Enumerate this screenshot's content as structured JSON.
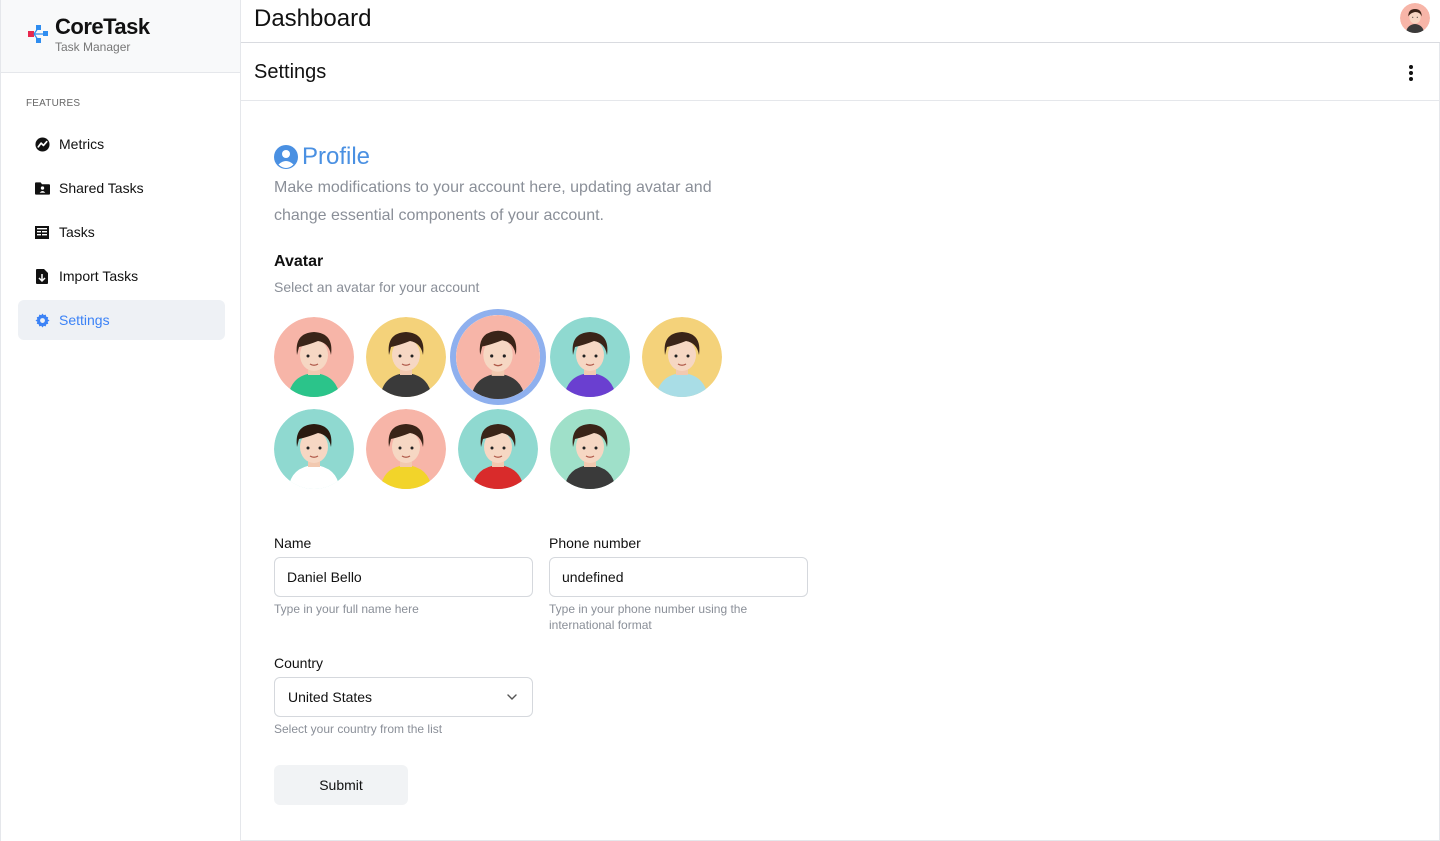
{
  "brand": {
    "name": "CoreTask",
    "subtitle": "Task Manager",
    "logo_icon": "coretask-logo-icon"
  },
  "sidebar": {
    "section_label": "FEATURES",
    "items": [
      {
        "label": "Metrics",
        "icon": "chart-line-icon",
        "active": false
      },
      {
        "label": "Shared Tasks",
        "icon": "shared-folder-icon",
        "active": false
      },
      {
        "label": "Tasks",
        "icon": "task-list-icon",
        "active": false
      },
      {
        "label": "Import Tasks",
        "icon": "file-import-icon",
        "active": false
      },
      {
        "label": "Settings",
        "icon": "gear-icon",
        "active": true
      }
    ]
  },
  "header": {
    "title": "Dashboard",
    "user_avatar_icon": "user-avatar"
  },
  "settings_bar": {
    "title": "Settings",
    "menu_icon": "more-vertical-icon"
  },
  "profile": {
    "title": "Profile",
    "icon": "user-circle-icon",
    "description": "Make modifications to your account here, updating avatar and change essential components of your account."
  },
  "avatar_section": {
    "title": "Avatar",
    "subtitle": "Select an avatar for your account",
    "selected_index": 2,
    "avatars": [
      {
        "bg": "#f7b5a8",
        "shirt": "#2bc48a",
        "hair": "#3a2418"
      },
      {
        "bg": "#f4d27a",
        "shirt": "#3a3a3a",
        "hair": "#3a2418"
      },
      {
        "bg": "#f7b5a8",
        "shirt": "#3a3a3a",
        "hair": "#3a2418"
      },
      {
        "bg": "#8fd9d0",
        "shirt": "#6a3fd0",
        "hair": "#3a2418"
      },
      {
        "bg": "#f4d27a",
        "shirt": "#a9dde6",
        "hair": "#3a2418"
      },
      {
        "bg": "#8fd9d0",
        "shirt": "#ffffff",
        "hair": "#2a1a10"
      },
      {
        "bg": "#f7b5a8",
        "shirt": "#f2d42a",
        "hair": "#3a2418"
      },
      {
        "bg": "#8fd9d0",
        "shirt": "#d92b2b",
        "hair": "#3a2418"
      },
      {
        "bg": "#9fe0c9",
        "shirt": "#3a3a3a",
        "hair": "#3a2418"
      }
    ]
  },
  "form": {
    "name": {
      "label": "Name",
      "value": "Daniel Bello",
      "helper": "Type in your full name here"
    },
    "phone": {
      "label": "Phone number",
      "value": "undefined",
      "helper_line1": "Type in your phone number using the",
      "helper_line2": "international format"
    },
    "country": {
      "label": "Country",
      "value": "United States",
      "helper": "Select your country from the list"
    },
    "submit_label": "Submit"
  },
  "colors": {
    "accent": "#3b82f6",
    "profile_blue": "#4a90e2",
    "selected_ring": "#8fb0ee"
  }
}
